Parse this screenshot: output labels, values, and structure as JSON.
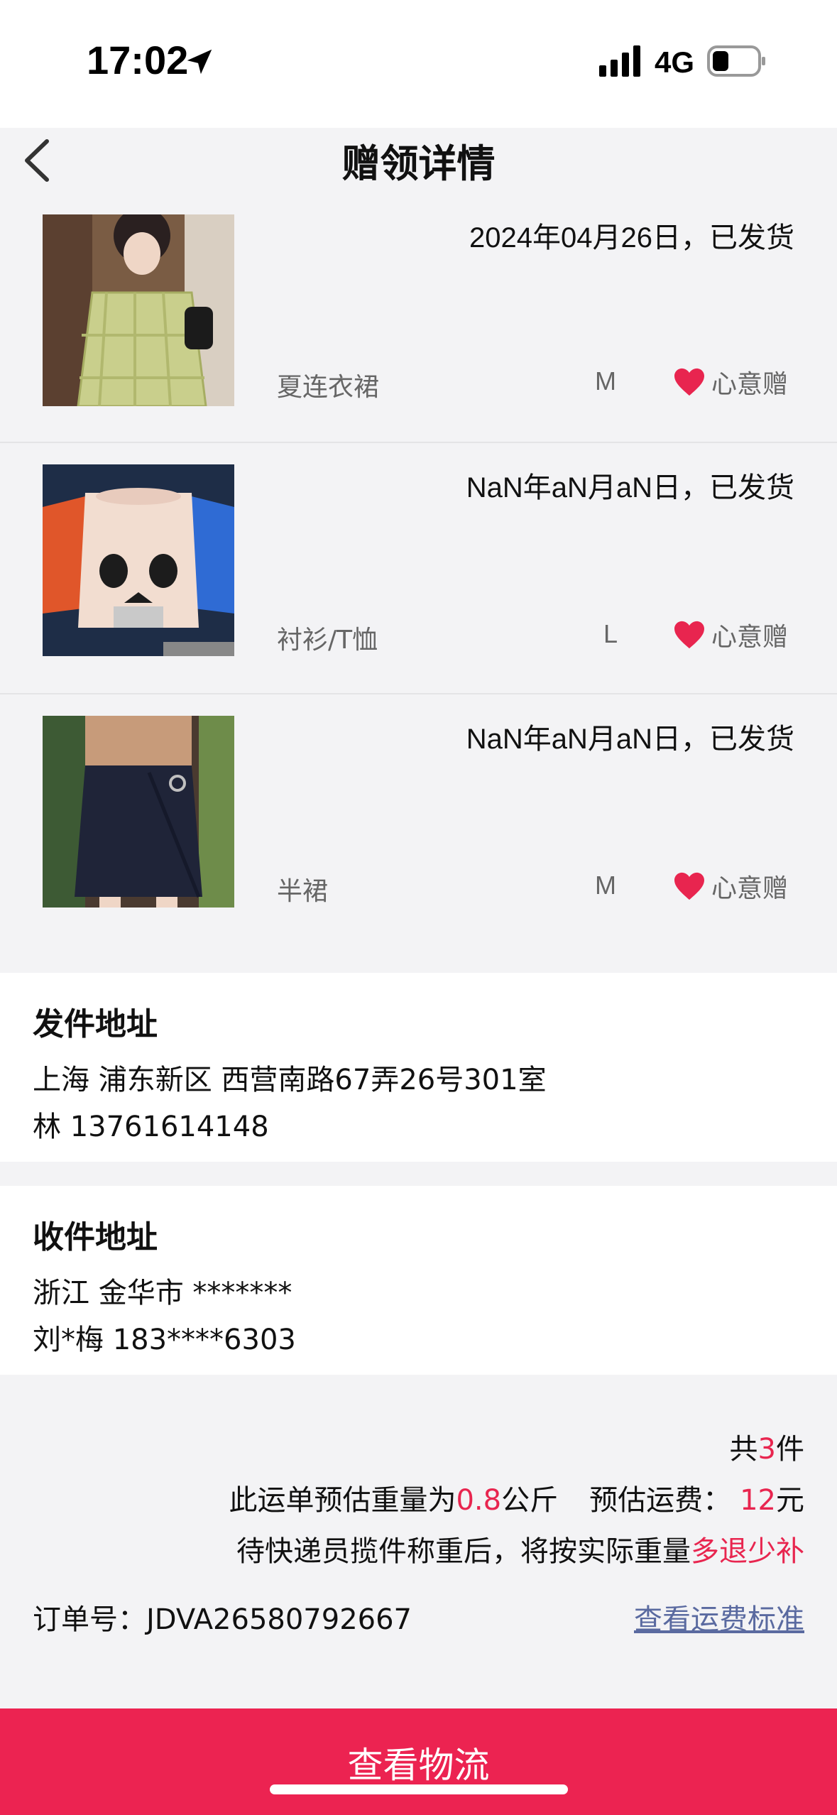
{
  "status": {
    "time": "17:02",
    "network": "4G"
  },
  "nav": {
    "title": "赠领详情"
  },
  "items": [
    {
      "date": "2024年04月26日，已发货",
      "name": "夏连衣裙",
      "size": "M",
      "tag": "心意赠",
      "thumb_icon": "plaid-dress-photo"
    },
    {
      "date": "NaN年aN月aN日，已发货",
      "name": "衬衫/T恤",
      "size": "L",
      "tag": "心意赠",
      "thumb_icon": "panda-shirt-photo"
    },
    {
      "date": "NaN年aN月aN日，已发货",
      "name": "半裙",
      "size": "M",
      "tag": "心意赠",
      "thumb_icon": "navy-skirt-photo"
    }
  ],
  "sender": {
    "title": "发件地址",
    "address": "上海 浦东新区 西营南路67弄26号301室",
    "contact": "林 13761614148"
  },
  "receiver": {
    "title": "收件地址",
    "address": "浙江 金华市 *******",
    "contact": "刘*梅 183****6303"
  },
  "summary": {
    "count_prefix": "共",
    "count": "3",
    "count_suffix": "件",
    "weight_prefix": "此运单预估重量为",
    "weight": "0.8",
    "weight_unit": "公斤",
    "fee_label": "预估运费：",
    "fee": "12",
    "fee_unit": "元",
    "note_prefix": "待快递员揽件称重后，将按实际重量",
    "note_accent": "多退少补"
  },
  "order": {
    "label": "订单号：JDVA26580792667",
    "link": "查看运费标准"
  },
  "bottom_button": {
    "label": "查看物流"
  },
  "colors": {
    "accent": "#e8254f",
    "button": "#ec2351",
    "heart": "#e8254f"
  }
}
